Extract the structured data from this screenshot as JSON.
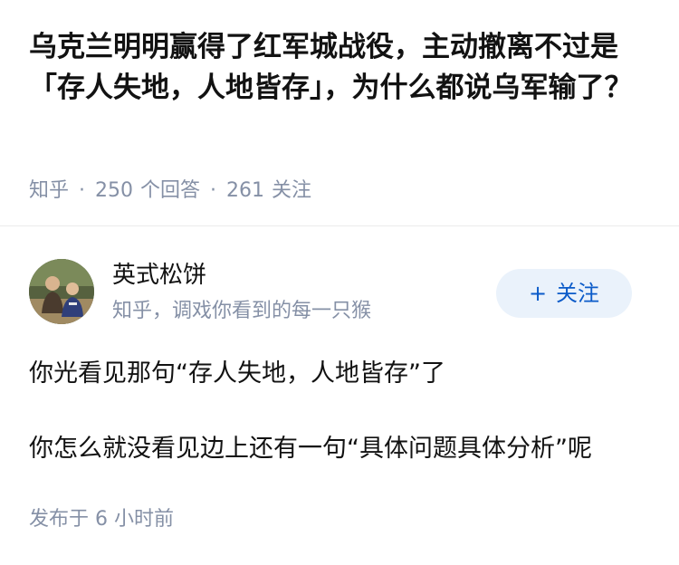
{
  "question": {
    "title": "乌克兰明明赢得了红军城战役，主动撤离不过是「存人失地，人地皆存」，为什么都说乌军输了？",
    "source": "知乎",
    "separator": "·",
    "answer_count": "250",
    "answer_label": "个回答",
    "follower_count": "261",
    "follower_label": "关注"
  },
  "author": {
    "name": "英式松饼",
    "bio": "知乎，调戏你看到的每一只猴",
    "follow_plus": "+",
    "follow_label": "关注"
  },
  "answer": {
    "lines": [
      "你光看见那句“存人失地，人地皆存”了",
      "你怎么就没看见边上还有一句“具体问题具体分析”呢"
    ],
    "publish_time": "发布于 6 小时前"
  },
  "colors": {
    "text_primary": "#121212",
    "text_secondary": "#8590a6",
    "follow_button_bg": "#eaf2fb",
    "follow_button_text": "#0b5bc9"
  }
}
